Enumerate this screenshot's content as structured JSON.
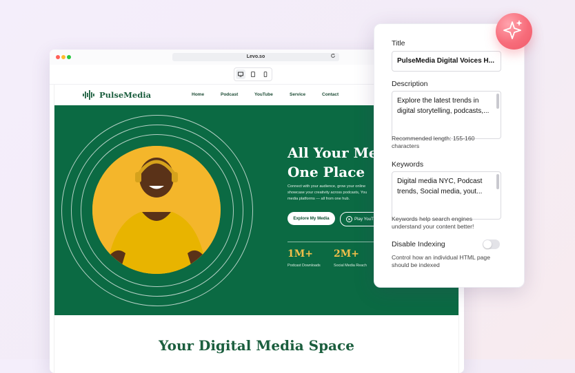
{
  "browser": {
    "url": "Levo.so",
    "traffic_lights": [
      "#ff5f57",
      "#febc2e",
      "#28c840"
    ]
  },
  "site": {
    "brand": "PulseMedia",
    "nav": [
      "Home",
      "Podcast",
      "YouTube",
      "Service",
      "Contact"
    ],
    "hero": {
      "title_line1": "All Your Med",
      "title_line2": "One Place",
      "subtitle_line1": "Connect with your audience, grow your online",
      "subtitle_line2": "showcase your creativity across podcasts, You",
      "subtitle_line3": "media platforms — all from one hub.",
      "primary_button": "Explore My Media",
      "secondary_button": "Play YouTu",
      "stats": [
        {
          "value": "1M+",
          "label": "Podcast Downloads"
        },
        {
          "value": "2M+",
          "label": "Social Media Reach"
        }
      ]
    },
    "section_title": "Your Digital Media Space",
    "colors": {
      "primary": "#0b6a43",
      "accent": "#f3c04a",
      "photo_bg": "#f4b62b"
    }
  },
  "seo_panel": {
    "title_label": "Title",
    "title_value": "PulseMedia Digital Voices H...",
    "description_label": "Description",
    "description_value": "Explore the latest trends in digital storytelling, podcasts,...",
    "description_help": "Recommended length: 155-160 characters",
    "keywords_label": "Keywords",
    "keywords_value": "Digital media NYC, Podcast trends, Social media, yout...",
    "keywords_help": "Keywords help search engines understand your content better!",
    "indexing_label": "Disable Indexing",
    "indexing_enabled": false,
    "indexing_help": "Control how an individual HTML page should be indexed"
  },
  "ai_badge_icon": "sparkle-icon"
}
